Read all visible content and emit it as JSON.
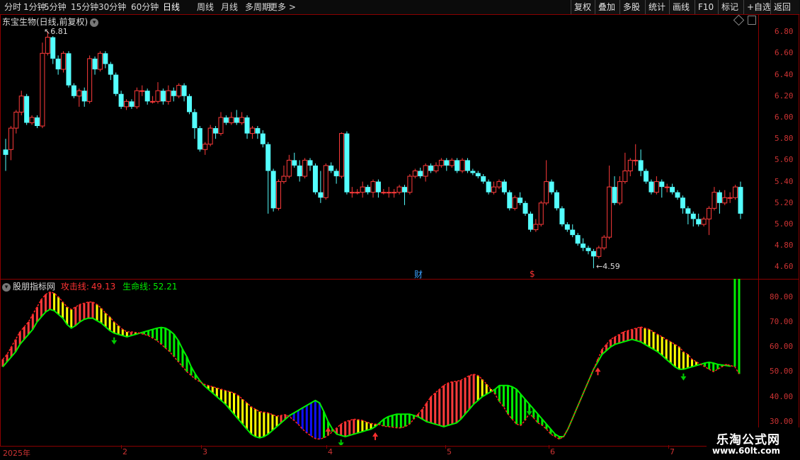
{
  "toolbar": {
    "periods": [
      "分时",
      "1分钟",
      "5分钟",
      "15分钟",
      "30分钟",
      "60分钟",
      "日线",
      "周线",
      "月线",
      "多周期",
      "更多 >"
    ],
    "active_period": "日线",
    "right_buttons": [
      "复权",
      "叠加",
      "多股",
      "统计",
      "画线",
      "F10",
      "标记",
      "+自选",
      "返回"
    ]
  },
  "main_chart": {
    "title": "东宝生物(日线,前复权)",
    "y_ticks": [
      "6.80",
      "6.60",
      "6.40",
      "6.20",
      "6.00",
      "5.80",
      "5.60",
      "5.40",
      "5.20",
      "5.00",
      "4.80",
      "4.60"
    ],
    "max_label": "6.81",
    "min_label": "4.59",
    "marker_cai": "财",
    "marker_dollar": "$"
  },
  "indicator": {
    "name": "股朋指标网",
    "attack_label": "攻击线:",
    "attack_value": "49.13",
    "life_label": "生命线:",
    "life_value": "52.21",
    "y_ticks": [
      "80.00",
      "70.00",
      "60.00",
      "50.00",
      "40.00",
      "30.00"
    ]
  },
  "date_axis": [
    "2025年",
    "2",
    "3",
    "4",
    "5",
    "6",
    "7"
  ],
  "watermark": {
    "name": "乐淘公式网",
    "url": "www.60lt.com"
  },
  "colors": {
    "up": "#ff3b3b",
    "down": "#54ffff",
    "frame": "#8b0000",
    "green": "#00ee00",
    "yellow": "#ffff00",
    "blue": "#1010ff"
  },
  "chart_data": [
    {
      "type": "candlestick",
      "title": "东宝生物(日线,前复权)",
      "ylim": [
        4.55,
        6.9
      ],
      "candles": [
        [
          5.7,
          5.65,
          5.8,
          5.5
        ],
        [
          5.7,
          5.9,
          5.92,
          5.6
        ],
        [
          5.9,
          6.05,
          6.07,
          5.85
        ],
        [
          6.05,
          6.2,
          6.25,
          6.02
        ],
        [
          6.2,
          5.95,
          6.22,
          5.93
        ],
        [
          5.95,
          6.0,
          6.02,
          5.93
        ],
        [
          6.0,
          5.92,
          6.02,
          5.9
        ],
        [
          5.92,
          6.6,
          6.7,
          5.9
        ],
        [
          6.6,
          6.75,
          6.81,
          6.58
        ],
        [
          6.75,
          6.55,
          6.76,
          6.5
        ],
        [
          6.55,
          6.45,
          6.58,
          6.4
        ],
        [
          6.45,
          6.6,
          6.62,
          6.42
        ],
        [
          6.6,
          6.3,
          6.62,
          6.28
        ],
        [
          6.3,
          6.2,
          6.32,
          6.18
        ],
        [
          6.2,
          6.25,
          6.27,
          6.1
        ],
        [
          6.25,
          6.15,
          6.28,
          6.1
        ],
        [
          6.15,
          6.55,
          6.58,
          6.13
        ],
        [
          6.55,
          6.45,
          6.57,
          6.4
        ],
        [
          6.45,
          6.6,
          6.62,
          6.43
        ],
        [
          6.6,
          6.5,
          6.62,
          6.46
        ],
        [
          6.5,
          6.4,
          6.52,
          6.35
        ],
        [
          6.4,
          6.22,
          6.42,
          6.2
        ],
        [
          6.22,
          6.1,
          6.25,
          6.08
        ],
        [
          6.1,
          6.15,
          6.17,
          6.07
        ],
        [
          6.15,
          6.1,
          6.17,
          6.08
        ],
        [
          6.1,
          6.25,
          6.28,
          6.08
        ],
        [
          6.25,
          6.25,
          6.3,
          6.2
        ],
        [
          6.25,
          6.15,
          6.27,
          6.12
        ],
        [
          6.15,
          6.15,
          6.2,
          6.13
        ],
        [
          6.15,
          6.25,
          6.33,
          6.13
        ],
        [
          6.25,
          6.15,
          6.27,
          6.12
        ],
        [
          6.15,
          6.25,
          6.3,
          6.12
        ],
        [
          6.25,
          6.2,
          6.28,
          6.15
        ],
        [
          6.2,
          6.3,
          6.32,
          6.18
        ],
        [
          6.3,
          6.2,
          6.32,
          6.15
        ],
        [
          6.2,
          6.05,
          6.22,
          6.03
        ],
        [
          6.05,
          5.9,
          6.08,
          5.8
        ],
        [
          5.9,
          5.7,
          5.92,
          5.68
        ],
        [
          5.7,
          5.75,
          5.77,
          5.65
        ],
        [
          5.75,
          5.9,
          5.93,
          5.73
        ],
        [
          5.9,
          5.85,
          5.92,
          5.8
        ],
        [
          5.85,
          6.0,
          6.05,
          5.83
        ],
        [
          6.0,
          5.95,
          6.02,
          5.93
        ],
        [
          5.95,
          6.0,
          6.05,
          5.93
        ],
        [
          6.0,
          5.95,
          6.07,
          5.93
        ],
        [
          5.95,
          6.0,
          6.05,
          5.93
        ],
        [
          6.0,
          5.85,
          6.02,
          5.8
        ],
        [
          5.85,
          5.9,
          5.92,
          5.8
        ],
        [
          5.9,
          5.85,
          5.92,
          5.8
        ],
        [
          5.85,
          5.75,
          5.88,
          5.72
        ],
        [
          5.75,
          5.5,
          5.77,
          5.1
        ],
        [
          5.5,
          5.15,
          5.52,
          5.12
        ],
        [
          5.15,
          5.4,
          5.42,
          5.13
        ],
        [
          5.4,
          5.45,
          5.55,
          5.38
        ],
        [
          5.45,
          5.6,
          5.65,
          5.43
        ],
        [
          5.6,
          5.55,
          5.67,
          5.53
        ],
        [
          5.55,
          5.45,
          5.6,
          5.4
        ],
        [
          5.45,
          5.6,
          5.62,
          5.43
        ],
        [
          5.6,
          5.55,
          5.62,
          5.5
        ],
        [
          5.55,
          5.3,
          5.57,
          5.28
        ],
        [
          5.3,
          5.25,
          5.5,
          5.2
        ],
        [
          5.25,
          5.55,
          5.57,
          5.23
        ],
        [
          5.55,
          5.5,
          5.58,
          5.48
        ],
        [
          5.5,
          5.45,
          5.52,
          5.38
        ],
        [
          5.45,
          5.85,
          5.86,
          5.43
        ],
        [
          5.85,
          5.3,
          5.87,
          5.28
        ],
        [
          5.3,
          5.3,
          5.35,
          5.25
        ],
        [
          5.3,
          5.3,
          5.33,
          5.28
        ],
        [
          5.3,
          5.35,
          5.4,
          5.25
        ],
        [
          5.35,
          5.3,
          5.37,
          5.28
        ],
        [
          5.3,
          5.4,
          5.42,
          5.25
        ],
        [
          5.4,
          5.3,
          5.42,
          5.25
        ],
        [
          5.3,
          5.3,
          5.33,
          5.28
        ],
        [
          5.3,
          5.3,
          5.35,
          5.25
        ],
        [
          5.3,
          5.3,
          5.33,
          5.25
        ],
        [
          5.3,
          5.35,
          5.37,
          5.28
        ],
        [
          5.35,
          5.3,
          5.37,
          5.18
        ],
        [
          5.3,
          5.45,
          5.47,
          5.28
        ],
        [
          5.45,
          5.5,
          5.52,
          5.43
        ],
        [
          5.5,
          5.45,
          5.53,
          5.43
        ],
        [
          5.45,
          5.55,
          5.57,
          5.4
        ],
        [
          5.55,
          5.5,
          5.57,
          5.48
        ],
        [
          5.5,
          5.55,
          5.58,
          5.48
        ],
        [
          5.55,
          5.6,
          5.62,
          5.53
        ],
        [
          5.6,
          5.55,
          5.62,
          5.5
        ],
        [
          5.55,
          5.6,
          5.62,
          5.53
        ],
        [
          5.6,
          5.5,
          5.62,
          5.48
        ],
        [
          5.5,
          5.6,
          5.62,
          5.48
        ],
        [
          5.6,
          5.5,
          5.62,
          5.48
        ],
        [
          5.5,
          5.48,
          5.52,
          5.46
        ],
        [
          5.48,
          5.45,
          5.5,
          5.43
        ],
        [
          5.45,
          5.4,
          5.47,
          5.38
        ],
        [
          5.4,
          5.3,
          5.42,
          5.28
        ],
        [
          5.3,
          5.35,
          5.4,
          5.28
        ],
        [
          5.35,
          5.4,
          5.42,
          5.33
        ],
        [
          5.4,
          5.3,
          5.42,
          5.28
        ],
        [
          5.3,
          5.15,
          5.32,
          5.13
        ],
        [
          5.15,
          5.25,
          5.27,
          5.13
        ],
        [
          5.25,
          5.2,
          5.3,
          5.18
        ],
        [
          5.2,
          5.1,
          5.22,
          5.08
        ],
        [
          5.1,
          4.95,
          5.12,
          4.93
        ],
        [
          4.95,
          5.0,
          5.05,
          4.93
        ],
        [
          5.0,
          5.2,
          5.22,
          4.98
        ],
        [
          5.2,
          5.4,
          5.6,
          5.18
        ],
        [
          5.4,
          5.3,
          5.42,
          5.28
        ],
        [
          5.3,
          5.15,
          5.32,
          5.13
        ],
        [
          5.15,
          5.0,
          5.17,
          4.98
        ],
        [
          5.0,
          4.95,
          5.02,
          4.93
        ],
        [
          4.95,
          4.9,
          5.0,
          4.88
        ],
        [
          4.9,
          4.82,
          4.92,
          4.8
        ],
        [
          4.82,
          4.78,
          4.87,
          4.75
        ],
        [
          4.78,
          4.75,
          4.8,
          4.72
        ],
        [
          4.75,
          4.7,
          4.77,
          4.59
        ],
        [
          4.7,
          4.78,
          4.8,
          4.68
        ],
        [
          4.78,
          4.88,
          4.9,
          4.76
        ],
        [
          4.88,
          5.35,
          5.55,
          4.86
        ],
        [
          5.35,
          5.2,
          5.45,
          5.18
        ],
        [
          5.2,
          5.4,
          5.45,
          5.18
        ],
        [
          5.4,
          5.5,
          5.67,
          5.38
        ],
        [
          5.5,
          5.6,
          5.62,
          5.45
        ],
        [
          5.6,
          5.6,
          5.75,
          5.55
        ],
        [
          5.6,
          5.5,
          5.7,
          5.45
        ],
        [
          5.5,
          5.4,
          5.52,
          5.38
        ],
        [
          5.4,
          5.3,
          5.42,
          5.28
        ],
        [
          5.3,
          5.4,
          5.45,
          5.28
        ],
        [
          5.4,
          5.35,
          5.42,
          5.25
        ],
        [
          5.35,
          5.35,
          5.38,
          5.3
        ],
        [
          5.35,
          5.3,
          5.38,
          5.28
        ],
        [
          5.3,
          5.25,
          5.32,
          5.23
        ],
        [
          5.25,
          5.15,
          5.27,
          5.1
        ],
        [
          5.15,
          5.1,
          5.17,
          5.0
        ],
        [
          5.1,
          5.05,
          5.12,
          4.98
        ],
        [
          5.05,
          5.0,
          5.1,
          4.98
        ],
        [
          5.0,
          5.05,
          5.07,
          4.98
        ],
        [
          5.05,
          5.15,
          5.17,
          4.9
        ],
        [
          5.15,
          5.3,
          5.35,
          5.13
        ],
        [
          5.3,
          5.2,
          5.32,
          5.1
        ],
        [
          5.2,
          5.25,
          5.32,
          5.18
        ],
        [
          5.25,
          5.25,
          5.3,
          5.2
        ],
        [
          5.25,
          5.35,
          5.37,
          5.23
        ],
        [
          5.35,
          5.1,
          5.4,
          5.05
        ]
      ]
    },
    {
      "type": "line",
      "title": "股朋指标网",
      "ylim": [
        22,
        85
      ],
      "series": [
        {
          "name": "攻击线",
          "values": [
            55,
            57,
            60,
            63,
            66,
            68,
            70,
            73,
            76,
            79,
            81,
            82,
            81.5,
            80,
            78,
            76,
            75,
            76,
            77,
            77.5,
            78,
            78,
            77,
            75.5,
            73.5,
            72,
            70,
            68.5,
            67,
            66,
            66,
            65.8,
            65.5,
            65,
            64.5,
            63.5,
            62.5,
            61,
            59.5,
            58,
            56,
            54,
            52,
            50,
            48.5,
            47,
            46,
            45,
            44.5,
            44,
            43.5,
            43,
            42.5,
            42,
            41.5,
            40.5,
            39,
            37.5,
            36,
            35,
            34,
            33.8,
            33.5,
            32.8,
            32.2,
            32.5,
            32.8,
            32,
            30.5,
            29,
            27,
            25.5,
            24.3,
            23.2,
            23,
            23.5,
            24.5,
            26,
            27.5,
            29,
            30,
            30.5,
            31,
            30.8,
            30.5,
            29.8,
            29.3,
            29,
            28.8,
            28.2,
            28,
            27.8,
            27.5,
            27.5,
            28,
            29,
            31,
            33,
            35,
            37.5,
            40,
            41.5,
            43,
            44.5,
            45.5,
            46,
            46.2,
            46.6,
            47.5,
            48.5,
            49,
            48.5,
            47,
            45,
            43,
            41,
            38,
            36,
            33,
            31,
            29,
            28.5,
            30.5,
            33.3,
            31.5,
            29.5,
            28.5,
            27,
            25,
            24,
            23,
            24,
            27,
            31,
            35,
            39,
            43,
            47,
            51,
            55,
            59,
            61,
            63,
            64,
            65,
            66,
            66.5,
            67,
            67.5,
            68,
            67.5,
            67,
            66,
            65,
            64,
            63,
            62,
            61,
            60,
            58,
            57,
            55,
            54,
            53,
            52,
            51,
            50,
            51,
            52,
            53,
            52.5,
            52,
            49.13
          ]
        },
        {
          "name": "生命线",
          "values": [
            52,
            54,
            56,
            58,
            61,
            63,
            65,
            67,
            70,
            72,
            74,
            75,
            74.5,
            73,
            71.5,
            69,
            67.5,
            68.5,
            70,
            71,
            71.5,
            71.5,
            70.5,
            69.5,
            68,
            66.5,
            65.5,
            65,
            64.5,
            64,
            64.5,
            65,
            65.5,
            66,
            66.5,
            67,
            67.5,
            67.8,
            67.5,
            66.5,
            65,
            62.5,
            59,
            56,
            52,
            49,
            46.5,
            44.5,
            43,
            41.5,
            40,
            38.5,
            37,
            35,
            33,
            31,
            29,
            27,
            25,
            24,
            23.5,
            24,
            25,
            26.5,
            28,
            29.5,
            31,
            32.5,
            33.5,
            34.5,
            35.5,
            36.5,
            37.5,
            38.5,
            37.5,
            34,
            30,
            27,
            25,
            24.5,
            24,
            24.5,
            25,
            25.5,
            26,
            26.5,
            27,
            28,
            29.5,
            31,
            32,
            32.5,
            33,
            33,
            33,
            33,
            32.5,
            32,
            31,
            30,
            29.5,
            29,
            28.5,
            28,
            28.5,
            29,
            29.5,
            31,
            33,
            35,
            37,
            38.5,
            40,
            41,
            42,
            43,
            44.5,
            44.5,
            44.5,
            44,
            43,
            41,
            39,
            37,
            35,
            33,
            31,
            29,
            27,
            25,
            24,
            24,
            27,
            31,
            35,
            39,
            43,
            47,
            51,
            54,
            57,
            58.5,
            60,
            61,
            61.5,
            62,
            62.5,
            63,
            62.5,
            62,
            61,
            60,
            59,
            58,
            56.5,
            55,
            53.5,
            52,
            51,
            51,
            51.5,
            52,
            52.5,
            53,
            53.5,
            53.8,
            53.5,
            53,
            52.7,
            52.5,
            52.21
          ]
        }
      ]
    }
  ]
}
